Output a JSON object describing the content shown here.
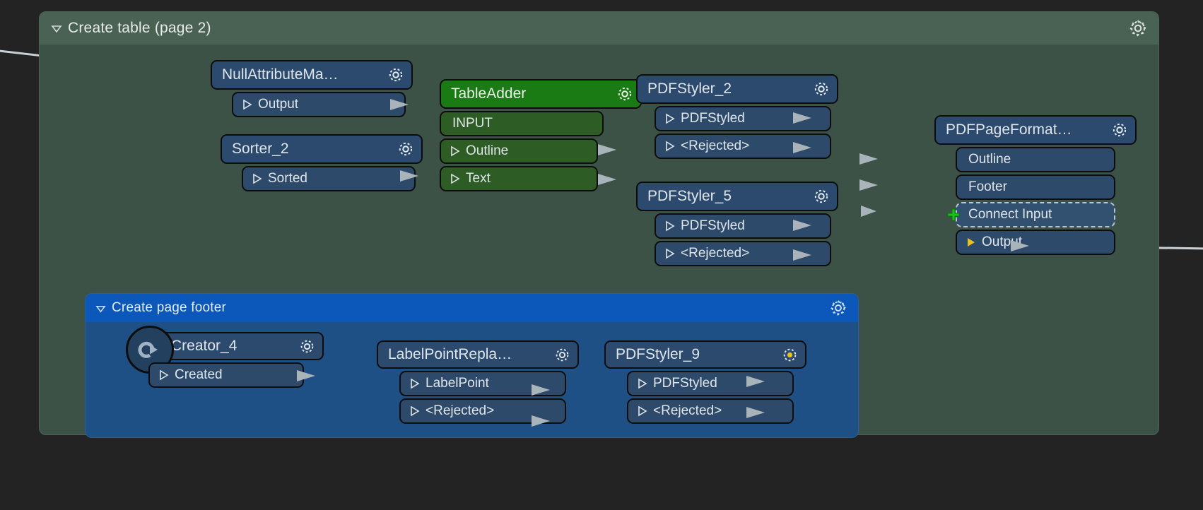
{
  "canvas": {
    "background": "#232323",
    "accent_green_group": "#3d5246",
    "accent_green_header": "#4a6254",
    "accent_blue_group": "#1e4f85",
    "accent_blue_header": "#0b57ba",
    "node_blue": "#2c4a6e",
    "node_green": "#1a7a14",
    "connector_grey": "#c4ccd1",
    "plus_green": "#19c21a",
    "output_yellow": "#e8c21a"
  },
  "groups": [
    {
      "id": "create-table",
      "title": "Create table (page 2)",
      "collapse_icon": "caret-down-icon",
      "gear_icon": "gear-icon"
    },
    {
      "id": "create-page-footer",
      "title": "Create page footer",
      "collapse_icon": "caret-down-icon",
      "gear_icon": "gear-icon"
    }
  ],
  "nodes": [
    {
      "id": "nullattributemapper",
      "title": "NullAttributeMa…",
      "gear_icon": "gear-icon",
      "gear_state": "normal",
      "ports": [
        {
          "label": "Output",
          "kind": "output",
          "marker": "triangle-hollow-icon"
        }
      ]
    },
    {
      "id": "sorter-2",
      "title": "Sorter_2",
      "gear_icon": "gear-icon",
      "gear_state": "normal",
      "ports": [
        {
          "label": "Sorted",
          "kind": "output",
          "marker": "triangle-hollow-icon"
        }
      ]
    },
    {
      "id": "tableadder",
      "title": "TableAdder",
      "gear_icon": "gear-icon",
      "gear_state": "normal",
      "ports": [
        {
          "label": "INPUT",
          "kind": "input",
          "marker": "none"
        },
        {
          "label": "Outline",
          "kind": "output",
          "marker": "triangle-hollow-icon"
        },
        {
          "label": "Text",
          "kind": "output",
          "marker": "triangle-hollow-icon"
        }
      ]
    },
    {
      "id": "pdfstyler-2",
      "title": "PDFStyler_2",
      "gear_icon": "gear-icon",
      "gear_state": "normal",
      "ports": [
        {
          "label": "PDFStyled",
          "kind": "output",
          "marker": "triangle-hollow-icon"
        },
        {
          "label": "<Rejected>",
          "kind": "output",
          "marker": "triangle-hollow-icon"
        }
      ]
    },
    {
      "id": "pdfstyler-5",
      "title": "PDFStyler_5",
      "gear_icon": "gear-icon",
      "gear_state": "normal",
      "ports": [
        {
          "label": "PDFStyled",
          "kind": "output",
          "marker": "triangle-hollow-icon"
        },
        {
          "label": "<Rejected>",
          "kind": "output",
          "marker": "triangle-hollow-icon"
        }
      ]
    },
    {
      "id": "pdfpageformatter",
      "title": "PDFPageFormat…",
      "gear_icon": "gear-icon",
      "gear_state": "normal",
      "ports": [
        {
          "label": "Outline",
          "kind": "input",
          "marker": "none"
        },
        {
          "label": "Footer",
          "kind": "input",
          "marker": "none"
        },
        {
          "label": "Connect Input",
          "kind": "connect",
          "marker": "plus-icon"
        },
        {
          "label": "Output",
          "kind": "output",
          "marker": "triangle-solid-yellow-icon"
        }
      ]
    },
    {
      "id": "creator-4",
      "title": "Creator_4",
      "gear_icon": "gear-icon",
      "gear_state": "normal",
      "badge_icon": "creator-circle-arrow-icon",
      "ports": [
        {
          "label": "Created",
          "kind": "output",
          "marker": "triangle-hollow-icon"
        }
      ]
    },
    {
      "id": "labelpointreplacer",
      "title": "LabelPointRepla…",
      "gear_icon": "gear-icon",
      "gear_state": "normal",
      "ports": [
        {
          "label": "LabelPoint",
          "kind": "output",
          "marker": "triangle-hollow-icon"
        },
        {
          "label": "<Rejected>",
          "kind": "output",
          "marker": "triangle-hollow-icon"
        }
      ]
    },
    {
      "id": "pdfstyler-9",
      "title": "PDFStyler_9",
      "gear_icon": "gear-icon",
      "gear_state": "modified",
      "ports": [
        {
          "label": "PDFStyled",
          "kind": "output",
          "marker": "triangle-hollow-icon"
        },
        {
          "label": "<Rejected>",
          "kind": "output",
          "marker": "triangle-hollow-icon"
        }
      ]
    }
  ],
  "labels": {
    "grp_table_title": "Create table (page 2)",
    "grp_footer_title": "Create page footer",
    "n_nullattr": "NullAttributeMa…",
    "n_nullattr_out": "Output",
    "n_sorter": "Sorter_2",
    "n_sorter_out": "Sorted",
    "n_tableadder": "TableAdder",
    "n_ta_input": "INPUT",
    "n_ta_outline": "Outline",
    "n_ta_text": "Text",
    "n_styler2": "PDFStyler_2",
    "n_styler2_p1": "PDFStyled",
    "n_styler2_p2": "<Rejected>",
    "n_styler5": "PDFStyler_5",
    "n_styler5_p1": "PDFStyled",
    "n_styler5_p2": "<Rejected>",
    "n_pageformat": "PDFPageFormat…",
    "n_pf_outline": "Outline",
    "n_pf_footer": "Footer",
    "n_pf_connect": "Connect Input",
    "n_pf_output": "Output",
    "n_creator": "Creator_4",
    "n_creator_out": "Created",
    "n_labelpoint": "LabelPointRepla…",
    "n_lp_p1": "LabelPoint",
    "n_lp_p2": "<Rejected>",
    "n_styler9": "PDFStyler_9",
    "n_styler9_p1": "PDFStyled",
    "n_styler9_p2": "<Rejected>"
  }
}
